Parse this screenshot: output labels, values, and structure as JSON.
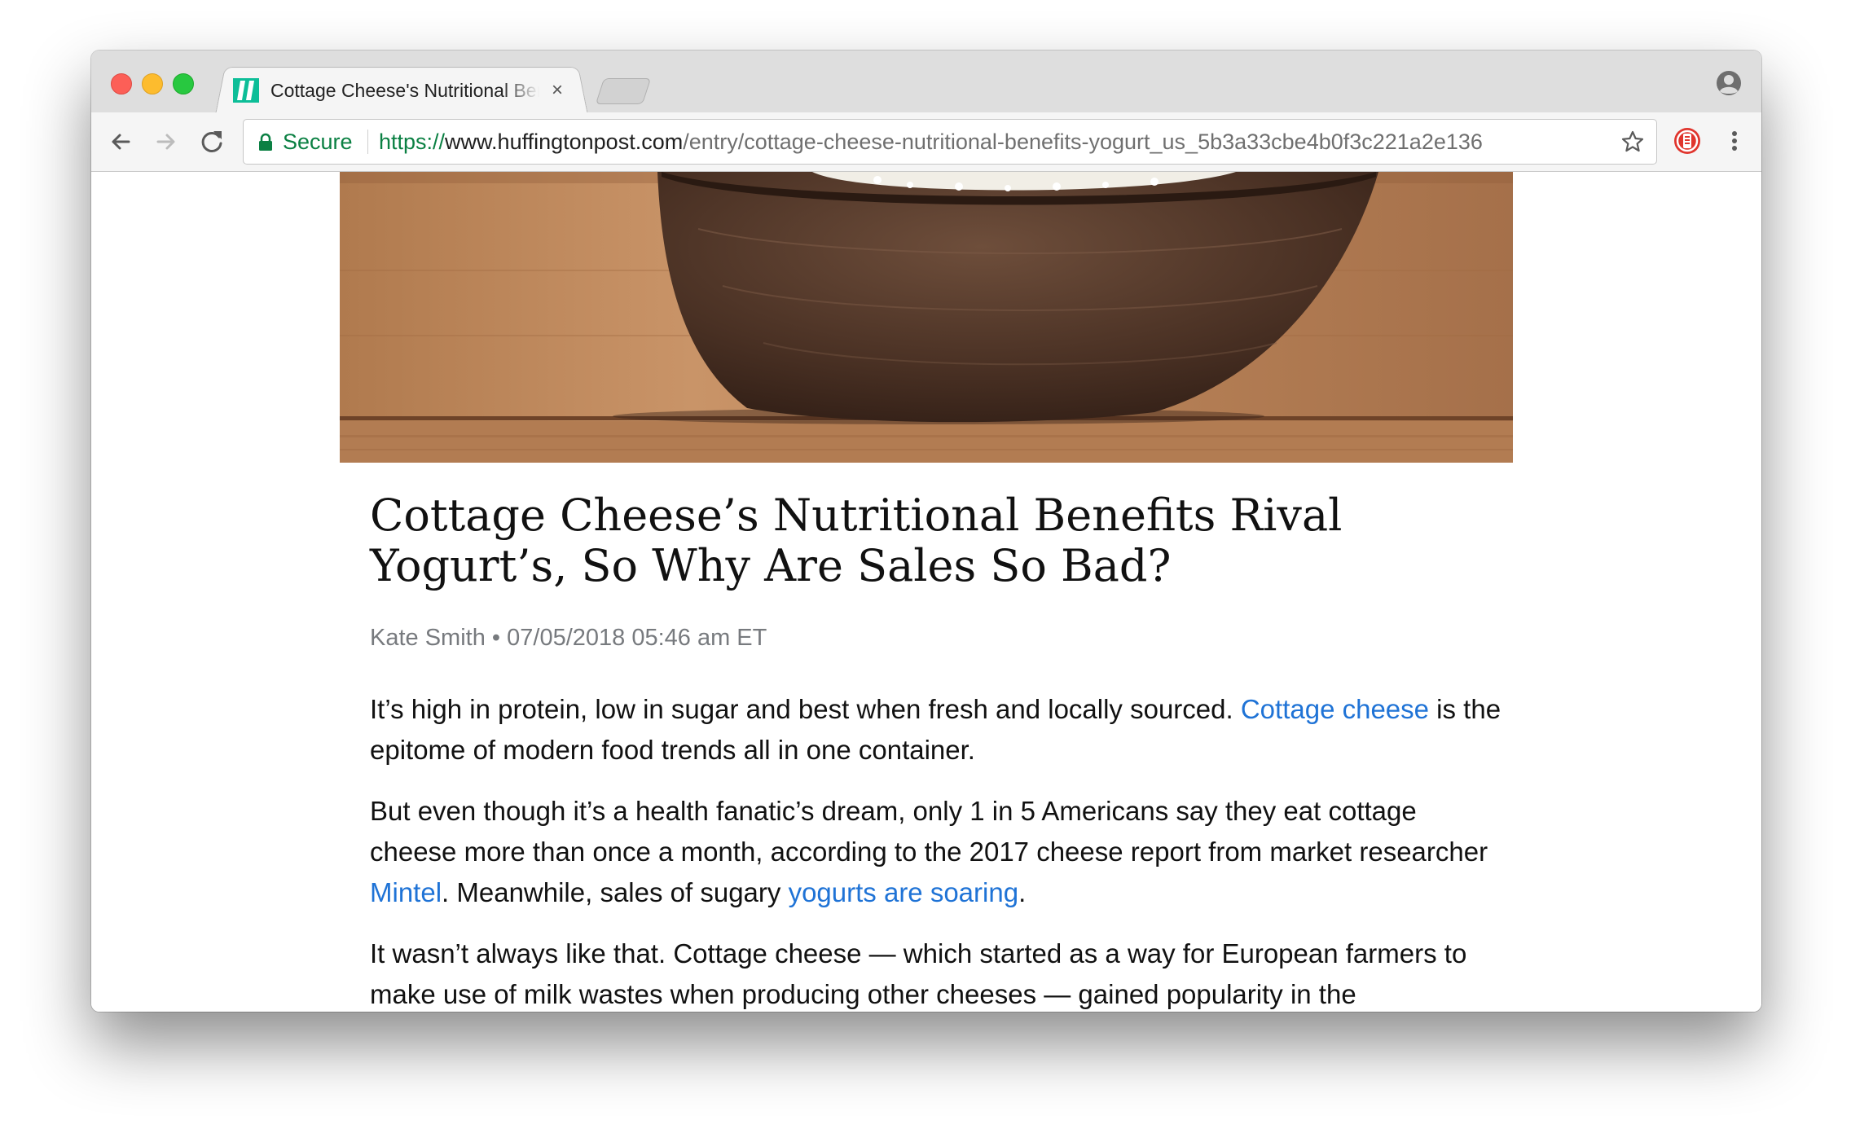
{
  "browser": {
    "tab": {
      "title": "Cottage Cheese's Nutritional Benefits Rival Yogurt's, So Why Are Sales So Bad?",
      "close_label": "×",
      "favicon": "huffpost-favicon"
    },
    "security_label": "Secure",
    "url": {
      "scheme": "https://",
      "host": "www.huffingtonpost.com",
      "path": "/entry/cottage-cheese-nutritional-benefits-yogurt_us_5b3a33cbe4b0f3c221a2e136"
    },
    "icons": [
      "back-icon",
      "forward-icon",
      "reload-icon",
      "lock-icon",
      "star-icon",
      "extension-icon",
      "menu-icon",
      "profile-icon"
    ]
  },
  "article": {
    "headline": "Cottage Cheese’s Nutritional Benefits Rival Yogurt’s, So Why Are Sales So Bad?",
    "author": "Kate Smith",
    "byline_sep": " • ",
    "date": "07/05/2018 05:46 am ET",
    "p1": {
      "text_a": "It’s high in protein, low in sugar and best when fresh and locally sourced. ",
      "link": "Cottage cheese",
      "text_b": " is the epitome of modern food trends all in one container."
    },
    "p2": {
      "text_a": "But even though it’s a health fanatic’s dream, only 1 in 5 Americans say they eat cottage cheese more than once a month, according to the 2017 cheese report from market researcher ",
      "link_1": "Mintel",
      "text_b": ". Meanwhile, sales of sugary ",
      "link_2": "yogurts are soaring",
      "text_c": "."
    },
    "p3": {
      "text": "It wasn’t always like that. Cottage cheese — which started as a way for European farmers to make use of milk wastes when producing other cheeses — gained popularity in the"
    }
  },
  "colors": {
    "link": "#1f73d6",
    "secure": "#0b8043",
    "byline": "#777a7e"
  }
}
